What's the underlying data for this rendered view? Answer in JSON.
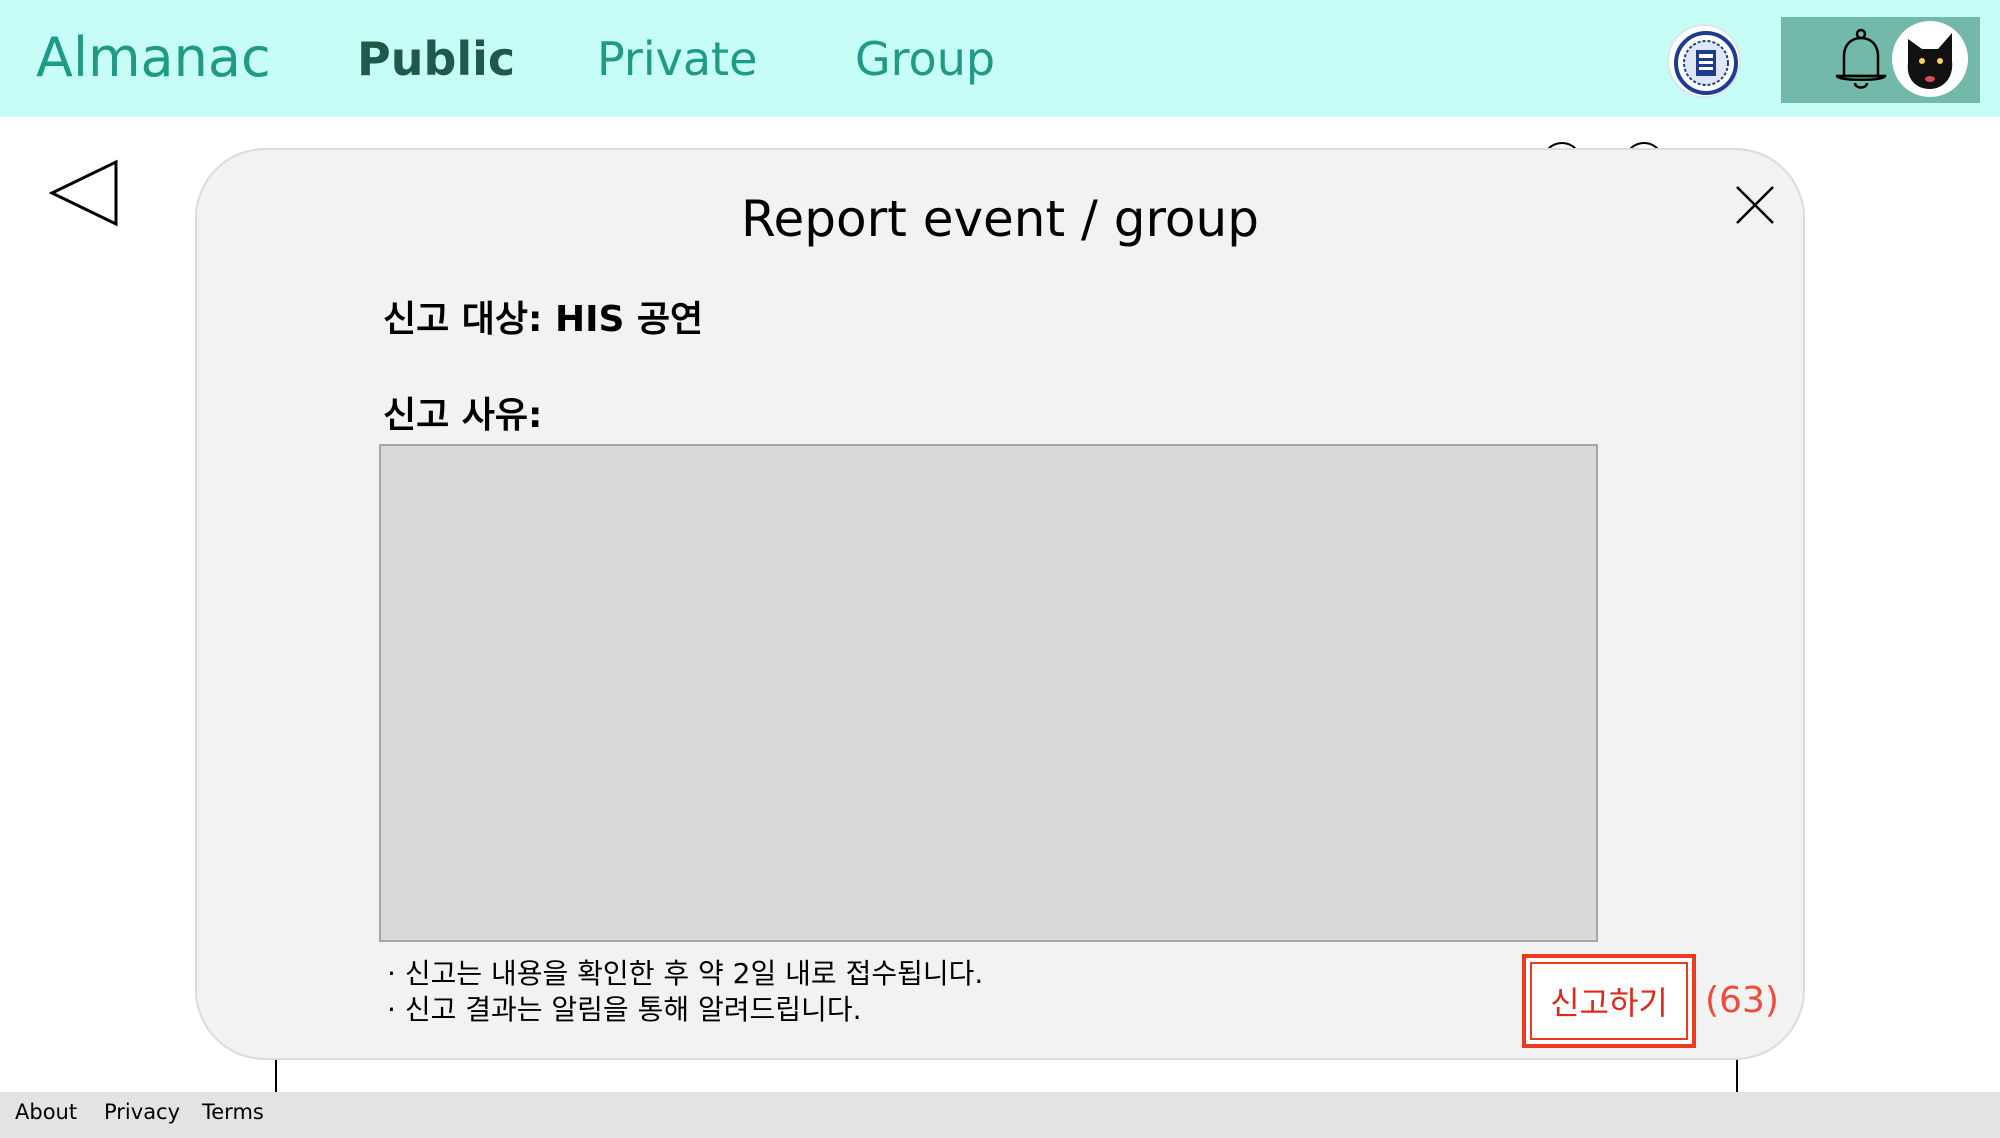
{
  "header": {
    "brand": "Almanac",
    "nav": [
      {
        "label": "Public",
        "active": true
      },
      {
        "label": "Private",
        "active": false
      },
      {
        "label": "Group",
        "active": false
      }
    ],
    "org_logo_icon": "university-seal-icon",
    "bell_icon": "bell-icon",
    "avatar_icon": "black-cat-avatar",
    "colors": {
      "bar": "#c6fdf6",
      "brand": "#1f9a84",
      "active_nav": "#1d5a4c",
      "user_panel": "#73b9aa"
    }
  },
  "modal": {
    "title": "Report event / group",
    "target_line": "신고 대상: HIS 공연",
    "reason_label": "신고 사유:",
    "reason_value": "",
    "notes": [
      "신고는 내용을 확인한 후 약 2일 내로 접수됩니다.",
      "신고 결과는 알림을 통해 알려드립니다."
    ],
    "submit_label": "신고하기",
    "counter": "(63)",
    "colors": {
      "modal_bg": "#f2f2f2",
      "textarea_bg": "#d9d9d9",
      "submit_border": "#ee3b1f",
      "counter": "#ef4b3c"
    }
  },
  "footer": {
    "links": [
      "About",
      "Privacy",
      "Terms"
    ]
  }
}
